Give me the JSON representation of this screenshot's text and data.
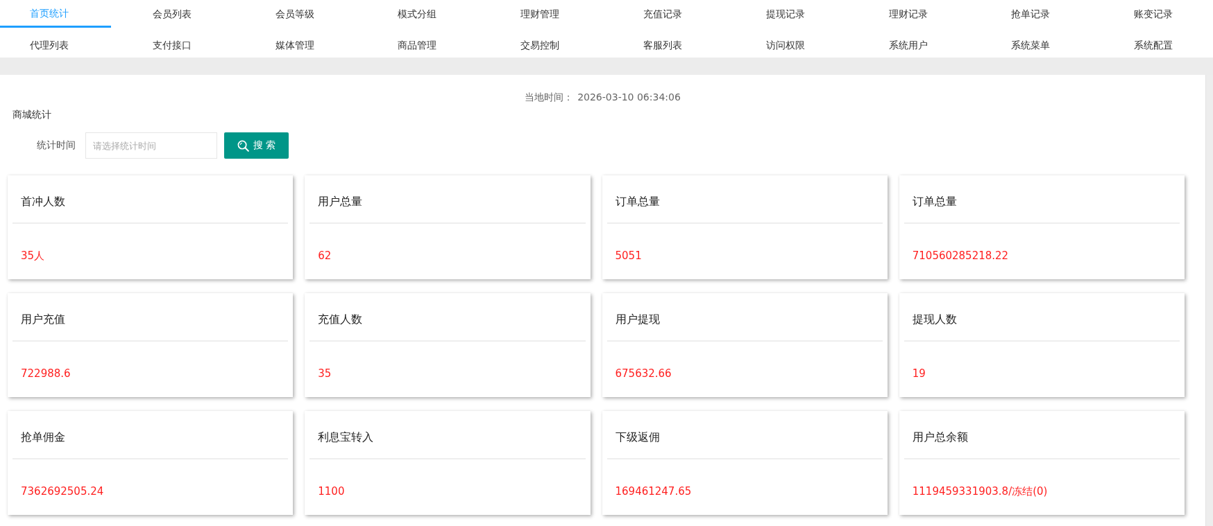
{
  "nav_tabs": [
    {
      "label": "首页统计",
      "selected": true
    },
    {
      "label": "会员列表",
      "selected": false
    },
    {
      "label": "会员等级",
      "selected": false
    },
    {
      "label": "模式分组",
      "selected": false
    },
    {
      "label": "理财管理",
      "selected": false
    },
    {
      "label": "充值记录",
      "selected": false
    },
    {
      "label": "提现记录",
      "selected": false
    },
    {
      "label": "理财记录",
      "selected": false
    },
    {
      "label": "抢单记录",
      "selected": false
    },
    {
      "label": "账变记录",
      "selected": false
    },
    {
      "label": "代理列表",
      "selected": false
    },
    {
      "label": "支付接口",
      "selected": false
    },
    {
      "label": "媒体管理",
      "selected": false
    },
    {
      "label": "商品管理",
      "selected": false
    },
    {
      "label": "交易控制",
      "selected": false
    },
    {
      "label": "客服列表",
      "selected": false
    },
    {
      "label": "访问权限",
      "selected": false
    },
    {
      "label": "系统用户",
      "selected": false
    },
    {
      "label": "系统菜单",
      "selected": false
    },
    {
      "label": "系统配置",
      "selected": false
    }
  ],
  "local_time": {
    "label": "当地时间：",
    "value": "2026-03-10 06:34:06"
  },
  "section_title": "商城统计",
  "filter": {
    "label": "统计时间",
    "placeholder": "请选择统计时间",
    "button": "搜 索"
  },
  "stats": [
    {
      "title": "首冲人数",
      "value": "35人"
    },
    {
      "title": "用户总量",
      "value": "62"
    },
    {
      "title": "订单总量",
      "value": "5051"
    },
    {
      "title": "订单总量",
      "value": "710560285218.22"
    },
    {
      "title": "用户充值",
      "value": "722988.6"
    },
    {
      "title": "充值人数",
      "value": "35"
    },
    {
      "title": "用户提现",
      "value": "675632.66"
    },
    {
      "title": "提现人数",
      "value": "19"
    },
    {
      "title": "抢单佣金",
      "value": "7362692505.24"
    },
    {
      "title": "利息宝转入",
      "value": "1100"
    },
    {
      "title": "下级返佣",
      "value": "169461247.65"
    },
    {
      "title": "用户总余额",
      "value": "1119459331903.8/冻结(0)"
    }
  ]
}
